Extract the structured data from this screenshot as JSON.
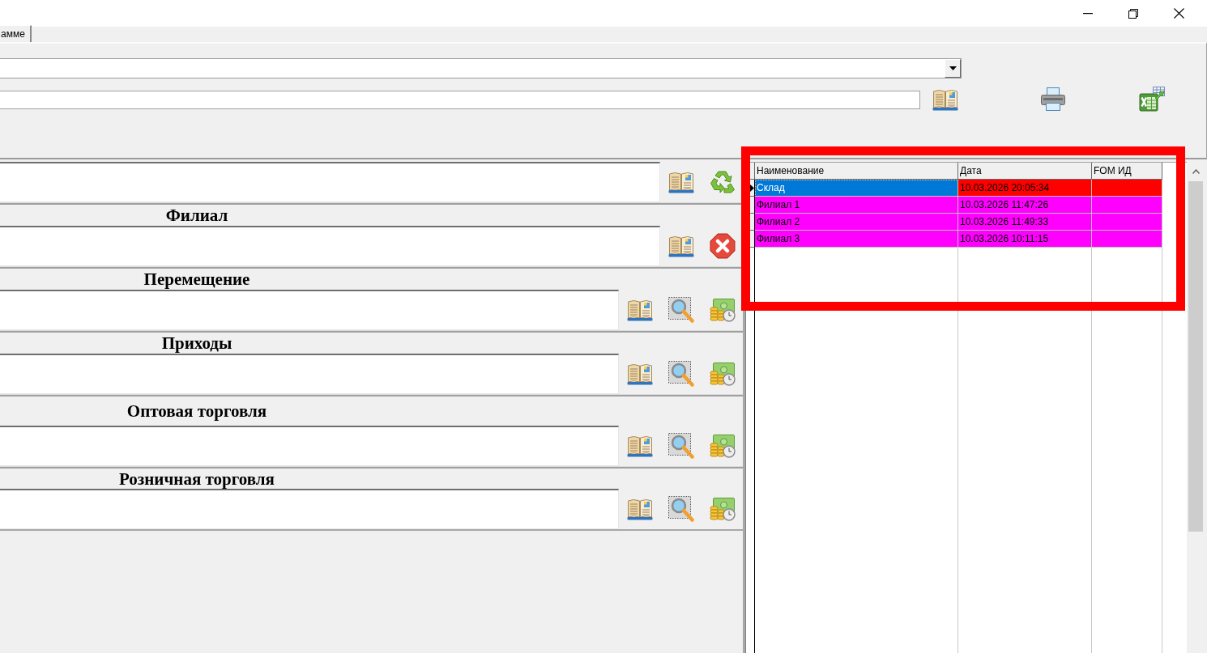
{
  "window": {
    "controls": [
      {
        "kind": "minimize"
      },
      {
        "kind": "restore"
      },
      {
        "kind": "close"
      }
    ]
  },
  "tabs": [
    {
      "label": "амме",
      "selected": true
    }
  ],
  "filter_panel": {
    "buttons": [
      {
        "kind": "book"
      },
      {
        "kind": "print"
      },
      {
        "kind": "excel"
      }
    ]
  },
  "sections": [
    {
      "buttons": [
        {
          "kind": "book"
        },
        {
          "kind": "recycle"
        }
      ]
    },
    {
      "heading": "Филиал",
      "buttons": [
        {
          "kind": "book"
        },
        {
          "kind": "delete"
        }
      ]
    },
    {
      "heading": "Перемещение",
      "buttons": [
        {
          "kind": "book"
        },
        {
          "kind": "search"
        },
        {
          "kind": "money"
        }
      ]
    },
    {
      "heading": "Приходы",
      "buttons": [
        {
          "kind": "book"
        },
        {
          "kind": "search"
        },
        {
          "kind": "money"
        }
      ]
    },
    {
      "heading": "Оптовая торговля",
      "buttons": [
        {
          "kind": "book"
        },
        {
          "kind": "search"
        },
        {
          "kind": "money"
        }
      ]
    },
    {
      "heading": "Розничная торговля",
      "buttons": [
        {
          "kind": "book"
        },
        {
          "kind": "search"
        },
        {
          "kind": "money"
        }
      ]
    }
  ],
  "grid": {
    "columns": [
      "Наименование",
      "Дата",
      "FOM ИД"
    ],
    "rows": [
      {
        "name": "Склад",
        "date": "10.03.2026 20:05:34",
        "color": "#ff0000",
        "selected": true
      },
      {
        "name": "Филиал 1",
        "date": "10.03.2026 11:47:26",
        "color": "#ff00ff",
        "selected": false
      },
      {
        "name": "Филиал 2",
        "date": "10.03.2026 11:49:33",
        "color": "#ff00ff",
        "selected": false
      },
      {
        "name": "Филиал 3",
        "date": "10.03.2026 10:11:15",
        "color": "#ff00ff",
        "selected": false
      }
    ]
  }
}
